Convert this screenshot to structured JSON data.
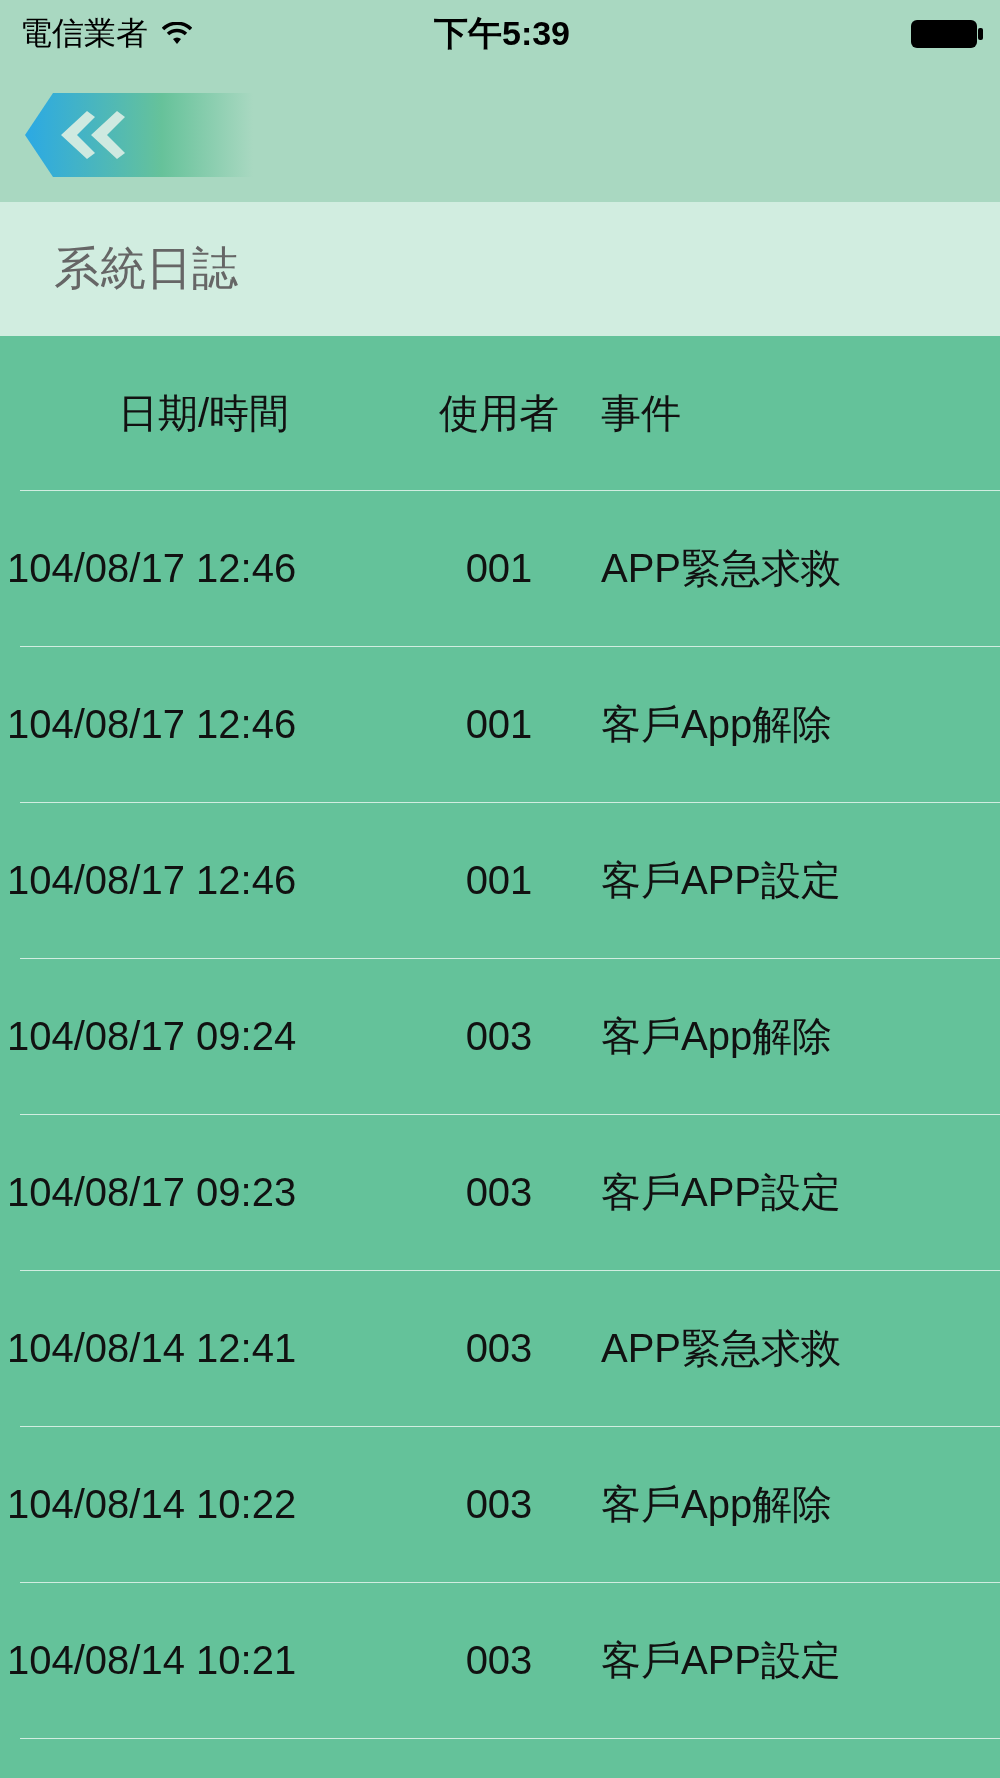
{
  "status_bar": {
    "carrier": "電信業者",
    "time": "下午5:39"
  },
  "title": "系統日誌",
  "table": {
    "columns": [
      "日期/時間",
      "使用者",
      "事件"
    ],
    "rows": [
      {
        "datetime": "104/08/17 12:46",
        "user": "001",
        "event": "APP緊急求救"
      },
      {
        "datetime": "104/08/17 12:46",
        "user": "001",
        "event": "客戶App解除"
      },
      {
        "datetime": "104/08/17 12:46",
        "user": "001",
        "event": "客戶APP設定"
      },
      {
        "datetime": "104/08/17 09:24",
        "user": "003",
        "event": "客戶App解除"
      },
      {
        "datetime": "104/08/17 09:23",
        "user": "003",
        "event": "客戶APP設定"
      },
      {
        "datetime": "104/08/14 12:41",
        "user": "003",
        "event": "APP緊急求救"
      },
      {
        "datetime": "104/08/14 10:22",
        "user": "003",
        "event": "客戶App解除"
      },
      {
        "datetime": "104/08/14 10:21",
        "user": "003",
        "event": "客戶APP設定"
      }
    ]
  }
}
